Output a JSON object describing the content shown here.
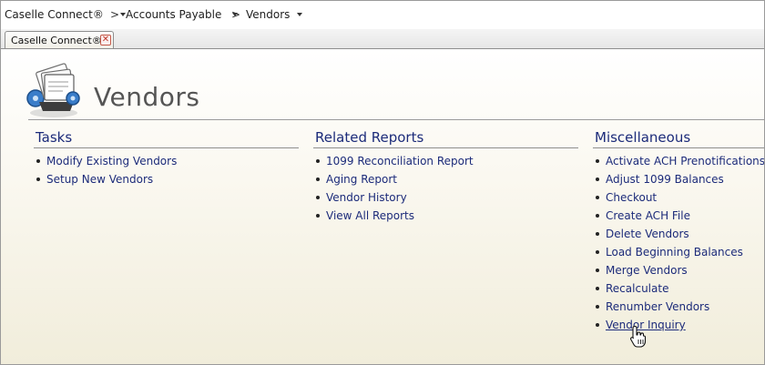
{
  "breadcrumb": {
    "items": [
      {
        "label": "Caselle Connect®"
      },
      {
        "label": "Accounts Payable"
      },
      {
        "label": "Vendors"
      }
    ],
    "separator": ">"
  },
  "tabs": [
    {
      "label": "Caselle Connect®",
      "close_glyph": "✕"
    }
  ],
  "page": {
    "title": "Vendors",
    "icon": "rolodex-icon"
  },
  "sections": {
    "tasks": {
      "heading": "Tasks",
      "links": [
        "Modify Existing Vendors",
        "Setup New Vendors"
      ]
    },
    "related_reports": {
      "heading": "Related Reports",
      "links": [
        "1099 Reconciliation Report",
        "Aging Report",
        "Vendor History",
        "View All Reports"
      ]
    },
    "miscellaneous": {
      "heading": "Miscellaneous",
      "links": [
        "Activate ACH Prenotifications",
        "Adjust 1099 Balances",
        "Checkout",
        "Create ACH File",
        "Delete Vendors",
        "Load Beginning Balances",
        "Merge Vendors",
        "Recalculate",
        "Renumber Vendors",
        "Vendor Inquiry"
      ]
    }
  },
  "colors": {
    "link": "#1c2b7a",
    "title": "#555555",
    "close": "#c0392b"
  }
}
